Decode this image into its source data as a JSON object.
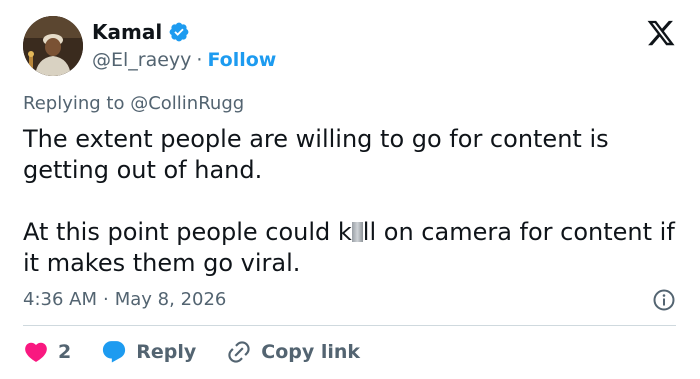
{
  "author": {
    "name": "Kamal",
    "handle": "@El_raeyy",
    "separator": "·",
    "follow_label": "Follow",
    "verified_color": "#1d9bf0"
  },
  "replying": {
    "prefix": "Replying to",
    "mention": "@CollinRugg"
  },
  "tweet": {
    "paragraph1": "The extent people are willing to go for content is getting out of hand.",
    "paragraph2_before": "At this point people could k",
    "paragraph2_after": "ll on camera for content if it makes them go viral."
  },
  "meta": {
    "time": "4:36 AM",
    "separator": "·",
    "date": "May 8, 2026"
  },
  "actions": {
    "like_count": "2",
    "reply_label": "Reply",
    "copy_label": "Copy link"
  },
  "colors": {
    "like": "#f91880",
    "reply": "#1d9bf0",
    "accent": "#1d9bf0",
    "muted": "#536471"
  },
  "icons": {
    "logo": "x-logo-icon",
    "verified": "verified-badge-icon",
    "info": "info-icon",
    "like": "heart-icon",
    "reply": "speech-bubble-icon",
    "copy": "link-icon"
  }
}
